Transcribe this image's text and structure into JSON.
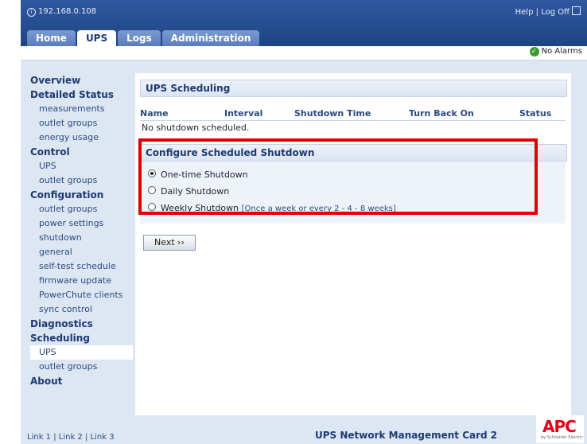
{
  "header": {
    "ip": "192.168.0.108",
    "help": "Help",
    "logoff": "Log Off",
    "separator": "|",
    "tabs": [
      {
        "label": "Home"
      },
      {
        "label": "UPS"
      },
      {
        "label": "Logs"
      },
      {
        "label": "Administration"
      }
    ],
    "active_tab": "UPS"
  },
  "status": {
    "alarms": "No Alarms"
  },
  "sidebar": {
    "overview": "Overview",
    "detailed_status": "Detailed Status",
    "ds_items": [
      "measurements",
      "outlet groups",
      "energy usage"
    ],
    "control": "Control",
    "ctl_items": [
      "UPS",
      "outlet groups"
    ],
    "configuration": "Configuration",
    "cfg_items": [
      "outlet groups",
      "power settings",
      "shutdown",
      "general",
      "self-test schedule",
      "firmware update",
      "PowerChute clients",
      "sync control"
    ],
    "diagnostics": "Diagnostics",
    "scheduling": "Scheduling",
    "sch_items": [
      "UPS",
      "outlet groups"
    ],
    "about": "About"
  },
  "main": {
    "section_title": "UPS Scheduling",
    "columns": [
      "Name",
      "Interval",
      "Shutdown Time",
      "Turn Back On",
      "Status"
    ],
    "empty_message": "No shutdown scheduled.",
    "configure_title": "Configure Scheduled Shutdown",
    "options": [
      "One-time Shutdown",
      "Daily Shutdown",
      "Weekly Shutdown"
    ],
    "selected_option": "One-time Shutdown",
    "weekly_hint": "[Once a week or every 2 - 4 - 8 weeks]",
    "next_button": "Next ››"
  },
  "footer": {
    "links": [
      "Link 1",
      "Link 2",
      "Link 3"
    ],
    "product": "UPS Network Management Card 2",
    "logo": "APC",
    "logo_sub": "by Schneider Electric"
  },
  "colors": {
    "header_blue": "#1d4584",
    "panel": "#dde6f3",
    "highlight": "#e10000",
    "brand_red": "#e3001b"
  }
}
